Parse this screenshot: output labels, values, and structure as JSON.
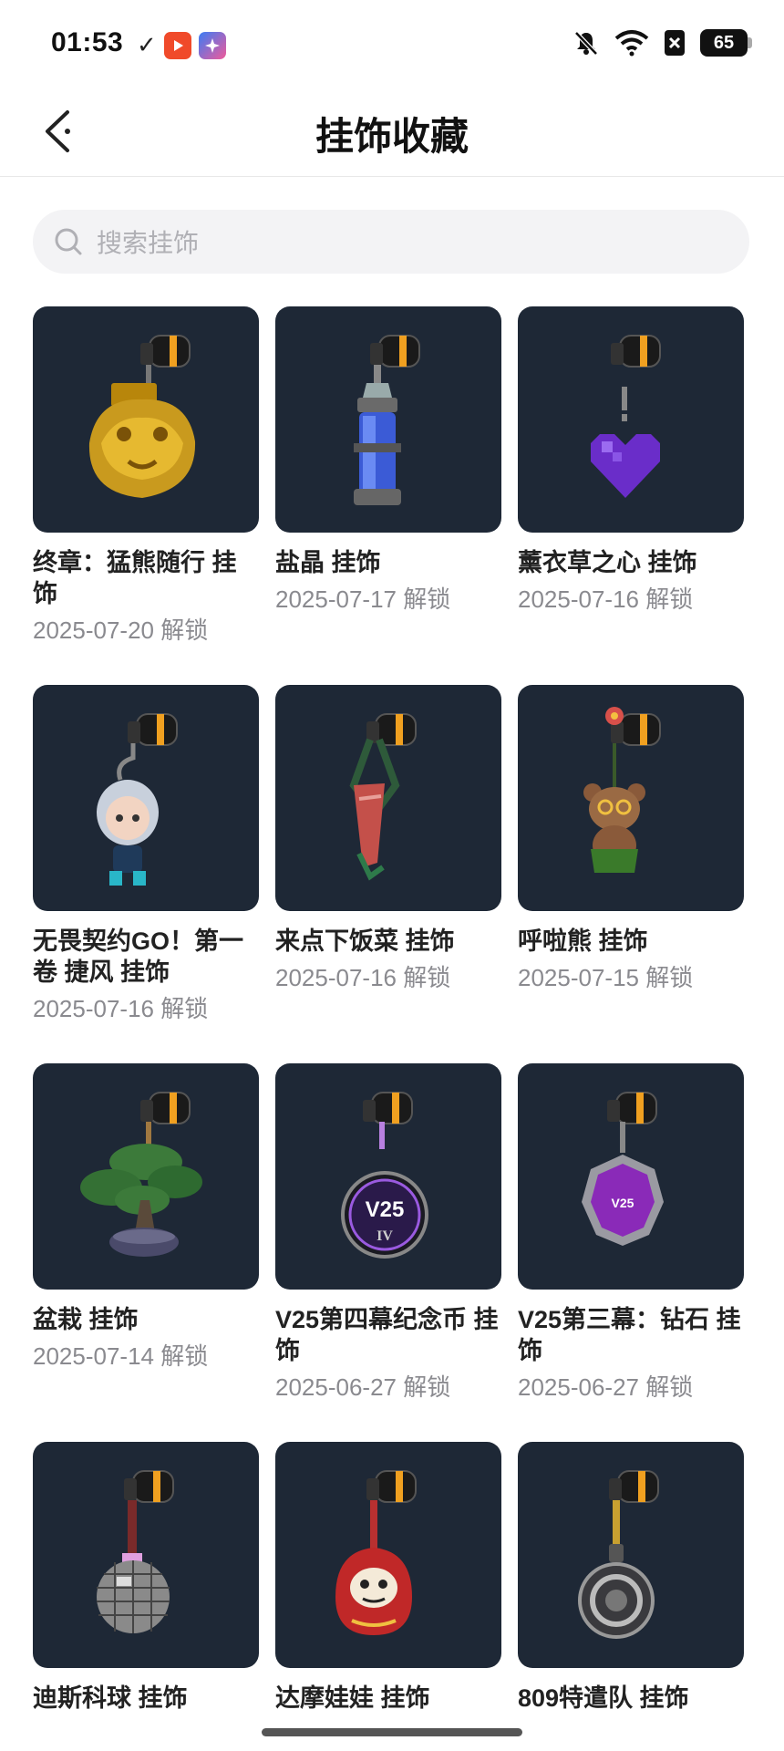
{
  "status": {
    "time": "01:53",
    "battery": "65"
  },
  "header": {
    "title": "挂饰收藏"
  },
  "search": {
    "placeholder": "搜索挂饰"
  },
  "items": [
    {
      "name": "终章：猛熊随行 挂饰",
      "date": "2025-07-20 解锁",
      "icon": "golden-bear-charm"
    },
    {
      "name": "盐晶 挂饰",
      "date": "2025-07-17 解锁",
      "icon": "salt-crystal-capsule-charm"
    },
    {
      "name": "薰衣草之心 挂饰",
      "date": "2025-07-16 解锁",
      "icon": "lavender-heart-charm"
    },
    {
      "name": "无畏契约GO！第一卷 捷风 挂饰",
      "date": "2025-07-16 解锁",
      "icon": "jett-figure-charm"
    },
    {
      "name": "来点下饭菜 挂饰",
      "date": "2025-07-16 解锁",
      "icon": "food-bag-charm"
    },
    {
      "name": "呼啦熊 挂饰",
      "date": "2025-07-15 解锁",
      "icon": "hula-bear-charm"
    },
    {
      "name": "盆栽 挂饰",
      "date": "2025-07-14 解锁",
      "icon": "bonsai-charm"
    },
    {
      "name": "V25第四幕纪念币 挂饰",
      "date": "2025-06-27 解锁",
      "icon": "v25-coin-charm"
    },
    {
      "name": "V25第三幕：钻石 挂饰",
      "date": "2025-06-27 解锁",
      "icon": "v25-diamond-charm"
    },
    {
      "name": "迪斯科球 挂饰",
      "date": "",
      "icon": "disco-ball-charm"
    },
    {
      "name": "达摩娃娃 挂饰",
      "date": "",
      "icon": "daruma-doll-charm"
    },
    {
      "name": "809特遣队 挂饰",
      "date": "",
      "icon": "809-squad-charm"
    }
  ],
  "colors": {
    "card_bg": "#1e2836",
    "clip_orange": "#f0a020"
  }
}
